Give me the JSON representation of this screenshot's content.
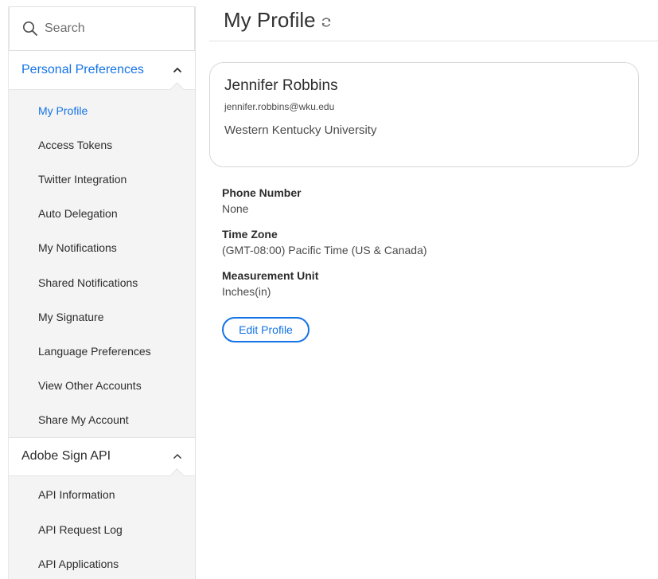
{
  "search": {
    "label": "Search"
  },
  "sidebar": {
    "sections": [
      {
        "title": "Personal Preferences",
        "expanded": true,
        "items": [
          {
            "label": "My Profile",
            "active": true
          },
          {
            "label": "Access Tokens"
          },
          {
            "label": "Twitter Integration"
          },
          {
            "label": "Auto Delegation"
          },
          {
            "label": "My Notifications"
          },
          {
            "label": "Shared Notifications"
          },
          {
            "label": "My Signature"
          },
          {
            "label": "Language Preferences"
          },
          {
            "label": "View Other Accounts"
          },
          {
            "label": "Share My Account"
          }
        ]
      },
      {
        "title": "Adobe Sign API",
        "expanded": true,
        "items": [
          {
            "label": "API Information"
          },
          {
            "label": "API Request Log"
          },
          {
            "label": "API Applications"
          }
        ]
      }
    ]
  },
  "page": {
    "title": "My Profile"
  },
  "profile": {
    "name": "Jennifer Robbins",
    "email": "jennifer.robbins@wku.edu",
    "organization": "Western Kentucky University"
  },
  "fields": {
    "phone": {
      "label": "Phone Number",
      "value": "None"
    },
    "timezone": {
      "label": "Time Zone",
      "value": "(GMT-08:00) Pacific Time (US & Canada)"
    },
    "measurement": {
      "label": "Measurement Unit",
      "value": "Inches(in)"
    }
  },
  "actions": {
    "edit_label": "Edit Profile"
  },
  "colors": {
    "accent": "#1473e6",
    "sidebar_bg": "#f4f4f4",
    "border": "#e1e1e1"
  },
  "icons": {
    "search": "search-icon",
    "refresh": "refresh-icon",
    "chevron": "chevron-up-icon"
  }
}
